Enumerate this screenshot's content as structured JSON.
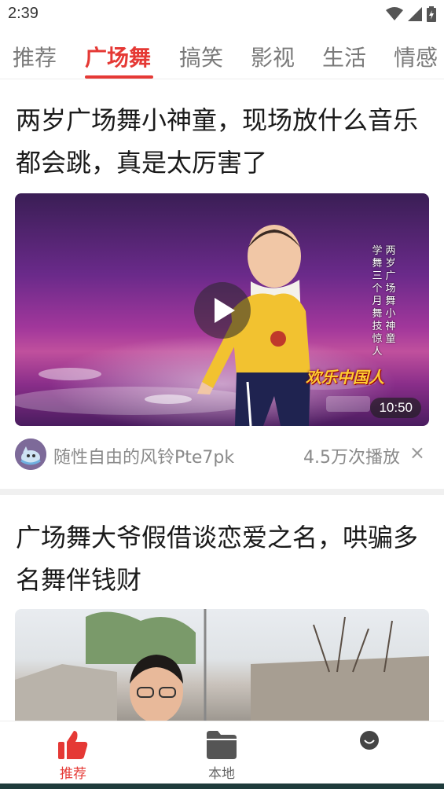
{
  "status_bar": {
    "time": "2:39"
  },
  "tabs": [
    {
      "label": "推荐"
    },
    {
      "label": "广场舞"
    },
    {
      "label": "搞笑"
    },
    {
      "label": "影视"
    },
    {
      "label": "生活"
    },
    {
      "label": "情感"
    }
  ],
  "active_tab": "广场舞",
  "colors": {
    "accent": "#e53935",
    "text_muted": "#8a8a8a"
  },
  "feed": [
    {
      "title": "两岁广场舞小神童，现场放什么音乐都会跳，真是太厉害了",
      "thumbnail_caption_right": "两岁广场舞小神童",
      "thumbnail_caption_left": "学舞三个月舞技惊人",
      "thumbnail_logo": "欢乐中国人",
      "duration": "10:50",
      "author": "随性自由的风铃Pte7pk",
      "plays": "4.5万次播放",
      "dismiss": "×"
    },
    {
      "title": "广场舞大爷假借谈恋爱之名，哄骗多名舞伴钱财"
    }
  ],
  "bottom_nav": [
    {
      "label": "推荐",
      "icon": "thumbs-up-icon"
    },
    {
      "label": "本地",
      "icon": "folder-icon"
    },
    {
      "label": "",
      "icon": "smiley-icon"
    }
  ]
}
